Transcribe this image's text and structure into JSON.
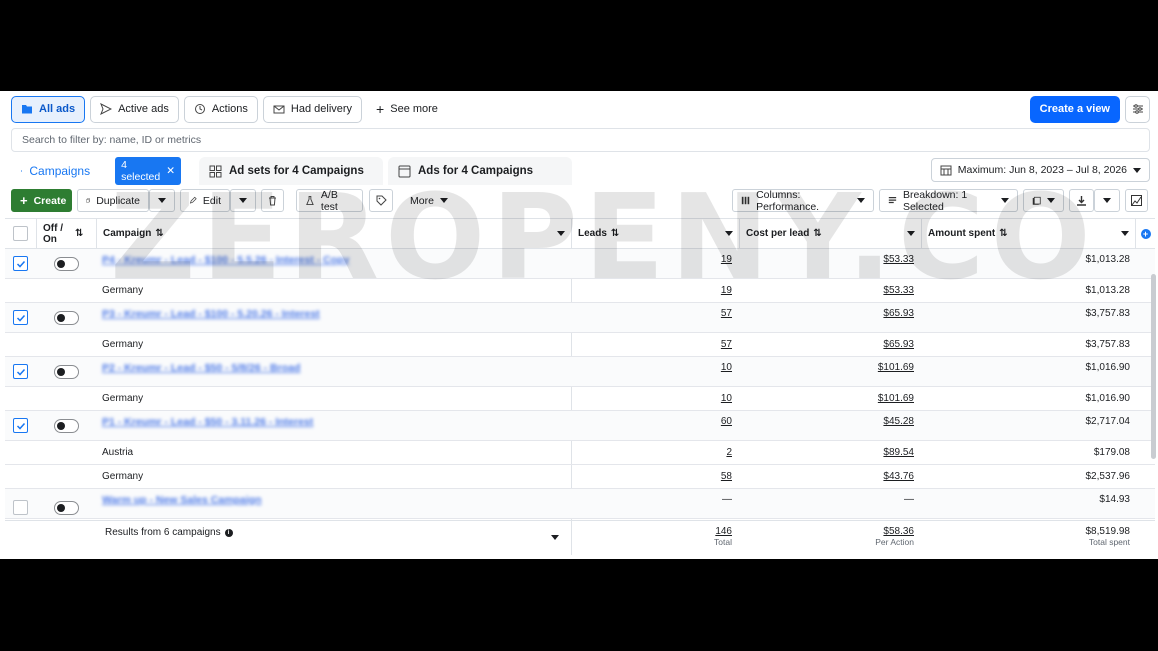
{
  "filters": [
    {
      "label": "All ads",
      "icon": "folder-icon",
      "active": true
    },
    {
      "label": "Active ads",
      "icon": "send-icon"
    },
    {
      "label": "Actions",
      "icon": "actions-icon"
    },
    {
      "label": "Had delivery",
      "icon": "envelope-icon"
    }
  ],
  "see_more": "See more",
  "create_view": "Create a view",
  "search_placeholder": "Search to filter by: name, ID or metrics",
  "tabs": {
    "campaigns": "Campaigns",
    "selected_badge": "4 selected",
    "adsets": "Ad sets for 4 Campaigns",
    "ads": "Ads for 4 Campaigns"
  },
  "date_range": "Maximum: Jun 8, 2023 – Jul 8, 2026",
  "toolbar": {
    "create": "Create",
    "duplicate": "Duplicate",
    "edit": "Edit",
    "ab_test": "A/B test",
    "more": "More",
    "columns": "Columns: Performance.",
    "breakdown": "Breakdown: 1 Selected"
  },
  "columns": {
    "offon": "Off / On",
    "campaign": "Campaign",
    "leads": "Leads",
    "cpl": "Cost per lead",
    "spent": "Amount spent"
  },
  "rows": [
    {
      "type": "campaign",
      "name": "P4 - Kreumr - Lead - $100 - 5.5.26 - Interest - Copy",
      "checked": true,
      "leads": "19",
      "cpl": "$53.33",
      "spent": "$1,013.28"
    },
    {
      "type": "breakdown",
      "name": "Germany",
      "leads": "19",
      "cpl": "$53.33",
      "spent": "$1,013.28"
    },
    {
      "type": "campaign",
      "name": "P3 - Kreumr - Lead - $100 - 5.20.26 - Interest",
      "checked": true,
      "leads": "57",
      "cpl": "$65.93",
      "spent": "$3,757.83"
    },
    {
      "type": "breakdown",
      "name": "Germany",
      "leads": "57",
      "cpl": "$65.93",
      "spent": "$3,757.83"
    },
    {
      "type": "campaign",
      "name": "P2 - Kreumr - Lead - $50 - 5/8/26 - Broad",
      "checked": true,
      "leads": "10",
      "cpl": "$101.69",
      "spent": "$1,016.90"
    },
    {
      "type": "breakdown",
      "name": "Germany",
      "leads": "10",
      "cpl": "$101.69",
      "spent": "$1,016.90"
    },
    {
      "type": "campaign",
      "name": "P1 - Kreumr - Lead - $50 - 3.11.26 - Interest",
      "checked": true,
      "leads": "60",
      "cpl": "$45.28",
      "spent": "$2,717.04"
    },
    {
      "type": "breakdown",
      "name": "Austria",
      "leads": "2",
      "cpl": "$89.54",
      "spent": "$179.08"
    },
    {
      "type": "breakdown",
      "name": "Germany",
      "leads": "58",
      "cpl": "$43.76",
      "spent": "$2,537.96"
    },
    {
      "type": "campaign",
      "name": "Warm up - New Sales Campaign",
      "checked": false,
      "leads": "—",
      "cpl": "—",
      "spent": "$14.93"
    }
  ],
  "footer": {
    "label": "Results from 6 campaigns",
    "leads": "146",
    "leads_sub": "Total",
    "cpl": "$58.36",
    "cpl_sub": "Per Action",
    "spent": "$8,519.98",
    "spent_sub": "Total spent"
  },
  "watermark": "ZEROPENY.CO"
}
